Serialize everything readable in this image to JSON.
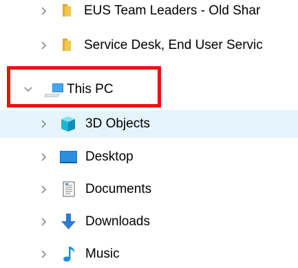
{
  "tree": {
    "items": [
      {
        "label": "EUS Team Leaders - Old Shar",
        "icon": "folder-icon",
        "expanded": false
      },
      {
        "label": "Service Desk, End User Servic",
        "icon": "folder-icon",
        "expanded": false
      },
      {
        "label": "This PC",
        "icon": "computer-icon",
        "expanded": true
      },
      {
        "label": "3D Objects",
        "icon": "3d-objects-icon",
        "expanded": false,
        "selected": true
      },
      {
        "label": "Desktop",
        "icon": "desktop-icon",
        "expanded": false
      },
      {
        "label": "Documents",
        "icon": "documents-icon",
        "expanded": false
      },
      {
        "label": "Downloads",
        "icon": "downloads-icon",
        "expanded": false
      },
      {
        "label": "Music",
        "icon": "music-icon",
        "expanded": false
      }
    ]
  },
  "colors": {
    "selection": "#e5f3fb",
    "highlight": "#ee1111",
    "folder": "#f2c84b",
    "chevron": "#8a8a8a",
    "downloads": "#2b7cd3",
    "music": "#1f8fe0"
  }
}
